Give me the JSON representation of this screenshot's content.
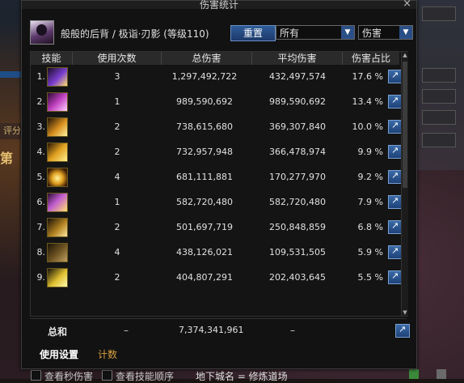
{
  "window": {
    "title": "伤害统计",
    "close_glyph": "×"
  },
  "header": {
    "character": "般般的后背 / 极诣·刃影 (等级110)",
    "reset_label": "重置",
    "filter_value": "所有",
    "metric_value": "伤害"
  },
  "columns": [
    "技能",
    "使用次数",
    "总伤害",
    "平均伤害",
    "伤害占比"
  ],
  "rows": [
    {
      "idx": "1.",
      "count": "3",
      "total": "1,297,492,722",
      "avg": "432,497,574",
      "pct": "17.6 %",
      "icon": "skill-icon-1"
    },
    {
      "idx": "2.",
      "count": "1",
      "total": "989,590,692",
      "avg": "989,590,692",
      "pct": "13.4 %",
      "icon": "skill-icon-2"
    },
    {
      "idx": "3.",
      "count": "2",
      "total": "738,615,680",
      "avg": "369,307,840",
      "pct": "10.0 %",
      "icon": "skill-icon-3"
    },
    {
      "idx": "4.",
      "count": "2",
      "total": "732,957,948",
      "avg": "366,478,974",
      "pct": "9.9 %",
      "icon": "skill-icon-4"
    },
    {
      "idx": "5.",
      "count": "4",
      "total": "681,111,881",
      "avg": "170,277,970",
      "pct": "9.2 %",
      "icon": "skill-icon-5"
    },
    {
      "idx": "6.",
      "count": "1",
      "total": "582,720,480",
      "avg": "582,720,480",
      "pct": "7.9 %",
      "icon": "skill-icon-6"
    },
    {
      "idx": "7.",
      "count": "2",
      "total": "501,697,719",
      "avg": "250,848,859",
      "pct": "6.8 %",
      "icon": "skill-icon-7"
    },
    {
      "idx": "8.",
      "count": "4",
      "total": "438,126,021",
      "avg": "109,531,505",
      "pct": "5.9 %",
      "icon": "skill-icon-8"
    },
    {
      "idx": "9.",
      "count": "2",
      "total": "404,807,291",
      "avg": "202,403,645",
      "pct": "5.5 %",
      "icon": "skill-icon-9"
    }
  ],
  "totals": {
    "label": "总和",
    "count": "–",
    "total": "7,374,341,961",
    "avg": "–"
  },
  "tabs": [
    "使用设置",
    "计数"
  ],
  "background": {
    "tab_label": "评分",
    "rank_label": "第",
    "check1": "查看秒伤害",
    "check2": "查看技能顺序",
    "map": "地下城名 = 修炼道场"
  },
  "colors": {
    "accent_blue": "#2f5c98",
    "gold": "#d8a040",
    "panel": "#121212"
  }
}
